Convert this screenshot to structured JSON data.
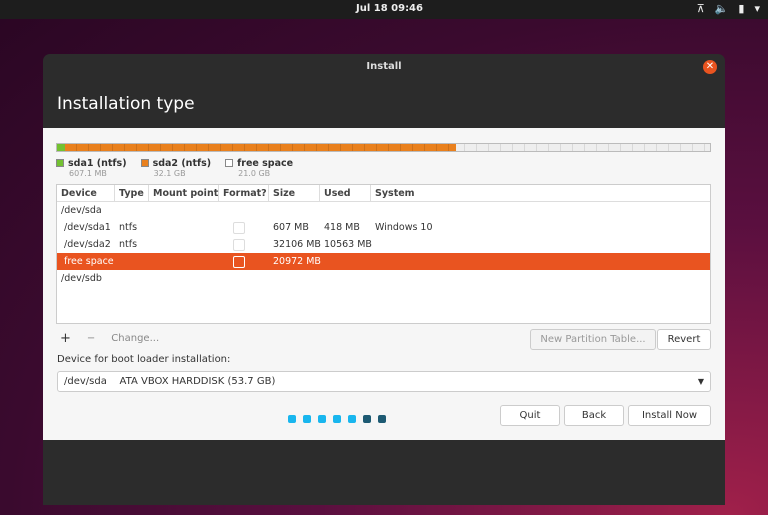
{
  "topbar": {
    "clock": "Jul 18  09:46",
    "icons": [
      "network-icon",
      "volume-icon",
      "battery-icon",
      "menu-arrow-icon"
    ]
  },
  "window": {
    "title": "Install",
    "heading": "Installation type"
  },
  "partition_bar": {
    "segments": [
      {
        "name": "sda1",
        "fraction": 0.013,
        "color": "#73c131"
      },
      {
        "name": "sda2",
        "fraction": 0.598,
        "color": "#e9801d"
      },
      {
        "name": "free",
        "fraction": 0.389,
        "color": "#eeeeee"
      }
    ]
  },
  "legend": [
    {
      "name": "sda1 (ntfs)",
      "size": "607.1 MB",
      "color": "#73c131"
    },
    {
      "name": "sda2 (ntfs)",
      "size": "32.1 GB",
      "color": "#e9801d"
    },
    {
      "name": "free space",
      "size": "21.0 GB",
      "color": "#ffffff"
    }
  ],
  "table": {
    "headers": [
      "Device",
      "Type",
      "Mount point",
      "Format?",
      "Size",
      "Used",
      "System"
    ],
    "rows": [
      {
        "device": "/dev/sda",
        "type": "",
        "mount": "",
        "format": false,
        "size": "",
        "used": "",
        "system": "",
        "group": true
      },
      {
        "device": " /dev/sda1",
        "type": "ntfs",
        "mount": "",
        "format": false,
        "size": "607 MB",
        "used": "418 MB",
        "system": "Windows 10"
      },
      {
        "device": " /dev/sda2",
        "type": "ntfs",
        "mount": "",
        "format": false,
        "size": "32106 MB",
        "used": "10563 MB",
        "system": ""
      },
      {
        "device": " free space",
        "type": "",
        "mount": "",
        "format": false,
        "size": "20972 MB",
        "used": "",
        "system": "",
        "selected": true
      },
      {
        "device": "/dev/sdb",
        "type": "",
        "mount": "",
        "format": false,
        "size": "",
        "used": "",
        "system": "",
        "group": true
      }
    ]
  },
  "tools": {
    "add": "+",
    "remove": "−",
    "change": "Change...",
    "new_table": "New Partition Table...",
    "revert": "Revert"
  },
  "bootloader": {
    "label": "Device for boot loader installation:",
    "value": "/dev/sda    ATA VBOX HARDDISK (53.7 GB)"
  },
  "buttons": {
    "quit": "Quit",
    "back": "Back",
    "install": "Install Now"
  },
  "progress": {
    "total": 7,
    "completed": 5,
    "active_color": "#19b6ee",
    "inactive_color": "#1d5a73"
  }
}
